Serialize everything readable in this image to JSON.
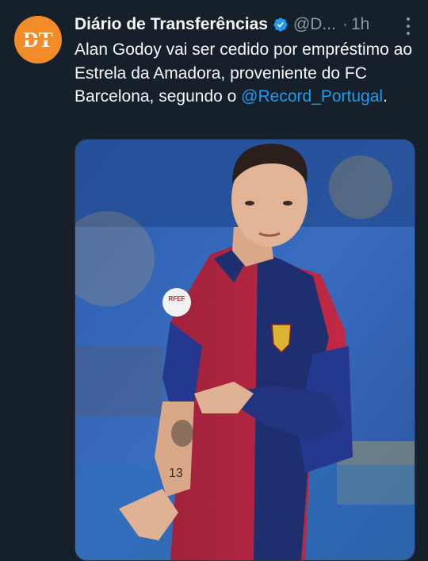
{
  "tweet": {
    "author_name": "Diário de Transferências",
    "handle": "@D...",
    "separator": "·",
    "time": "1h",
    "avatar_label": "DT",
    "text_main": "Alan Godoy vai ser cedido por empréstimo ao Estrela da Amadora, proveniente do FC Barcelona, segundo o ",
    "mention": "@Record_Portugal",
    "text_end": ".",
    "icons": {
      "verified": "verified-badge-icon",
      "more": "more-options-icon"
    },
    "colors": {
      "background": "#15202b",
      "link": "#1d9bf0",
      "verified": "#1d9bf0",
      "avatar": "#f28c28"
    }
  },
  "photo": {
    "jersey_badge_text": "RFEF",
    "arm_tattoo_number": "13",
    "description_icon": "player-photo"
  }
}
